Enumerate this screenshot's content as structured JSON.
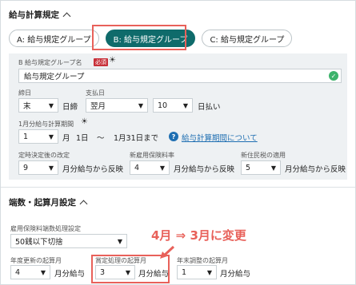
{
  "colors": {
    "accent": "#0f6b6b",
    "highlight": "#e8615a",
    "link": "#1f6fb2",
    "success": "#3db36b",
    "required": "#c8313a"
  },
  "section1": {
    "title": "給与計算規定",
    "tabs": [
      {
        "label": "A: 給与規定グループ",
        "active": false
      },
      {
        "label": "B: 給与規定グループ",
        "active": true
      },
      {
        "label": "C: 給与規定グループ",
        "active": false
      }
    ],
    "group_name": {
      "label": "B 給与規定グループ名",
      "required": "必須",
      "value": "給与規定グループ"
    },
    "closing": {
      "label": "締日",
      "value": "末",
      "suffix": "日締"
    },
    "payday": {
      "label": "支払日",
      "month": "翌月",
      "day": "10",
      "suffix": "日払い"
    },
    "period": {
      "label": "1月分給与計算期間",
      "month": "1",
      "month_unit": "月",
      "day": "1日",
      "tilde": "〜",
      "end": "1月31日まで",
      "link": "給与計算期間について"
    },
    "fields": [
      {
        "label": "定時決定後の改定",
        "value": "9",
        "suffix": "月分給与から反映"
      },
      {
        "label": "新雇用保険料率",
        "value": "4",
        "suffix": "月分給与から反映"
      },
      {
        "label": "新住民税の適用",
        "value": "5",
        "suffix": "月分給与から反映"
      }
    ]
  },
  "section2": {
    "title": "端数・起算月設定",
    "rounding": {
      "label": "雇用保険料端数処理設定",
      "value": "50銭以下切捨"
    },
    "fields": [
      {
        "label": "年度更新の起算月",
        "value": "4",
        "suffix": "月分給与"
      },
      {
        "label": "賞定処理の起算月",
        "value": "3",
        "suffix": "月分給与"
      },
      {
        "label": "年末調整の起算月",
        "value": "1",
        "suffix": "月分給与"
      }
    ]
  },
  "annotation": {
    "text": "4月 ⇒ 3月に変更"
  }
}
